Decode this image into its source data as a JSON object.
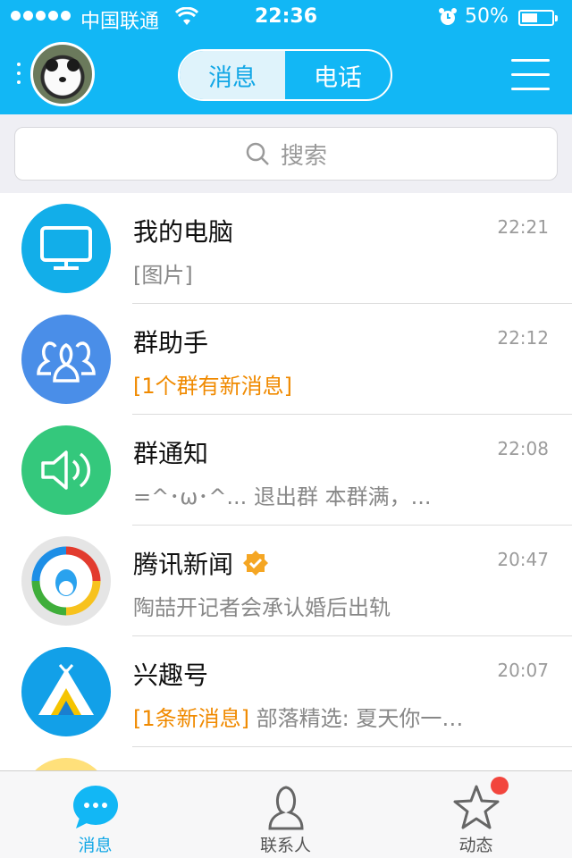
{
  "status_bar": {
    "carrier": "中国联通",
    "time": "22:36",
    "battery": "50%"
  },
  "header": {
    "tabs": [
      {
        "label": "消息",
        "active": true
      },
      {
        "label": "电话",
        "active": false
      }
    ]
  },
  "search": {
    "placeholder": "搜索"
  },
  "conversations": [
    {
      "name": "我的电脑",
      "time": "22:21",
      "highlight": "",
      "preview": "[图片]",
      "avatar_color": "#12aee9",
      "icon": "monitor-icon"
    },
    {
      "name": "群助手",
      "time": "22:12",
      "highlight": "[1个群有新消息]",
      "preview": "",
      "avatar_color": "#4a8ee8",
      "icon": "group-icon"
    },
    {
      "name": "群通知",
      "time": "22:08",
      "highlight": "",
      "preview": "=^･ω･^... 退出群 本群满，...",
      "avatar_color": "#34c87c",
      "icon": "speaker-icon"
    },
    {
      "name": "腾讯新闻",
      "time": "20:47",
      "highlight": "",
      "preview": "陶喆开记者会承认婚后出轨",
      "avatar_color": "#e5e5e5",
      "icon": "tencent-news-icon",
      "verified": true
    },
    {
      "name": "兴趣号",
      "time": "20:07",
      "highlight": "[1条新消息]",
      "preview": " 部落精选: 夏天你一…",
      "avatar_color": "#12a0e8",
      "icon": "tent-icon"
    }
  ],
  "tab_bar": {
    "items": [
      {
        "label": "消息",
        "active": true
      },
      {
        "label": "联系人",
        "active": false
      },
      {
        "label": "动态",
        "active": false,
        "badge": true
      }
    ]
  }
}
